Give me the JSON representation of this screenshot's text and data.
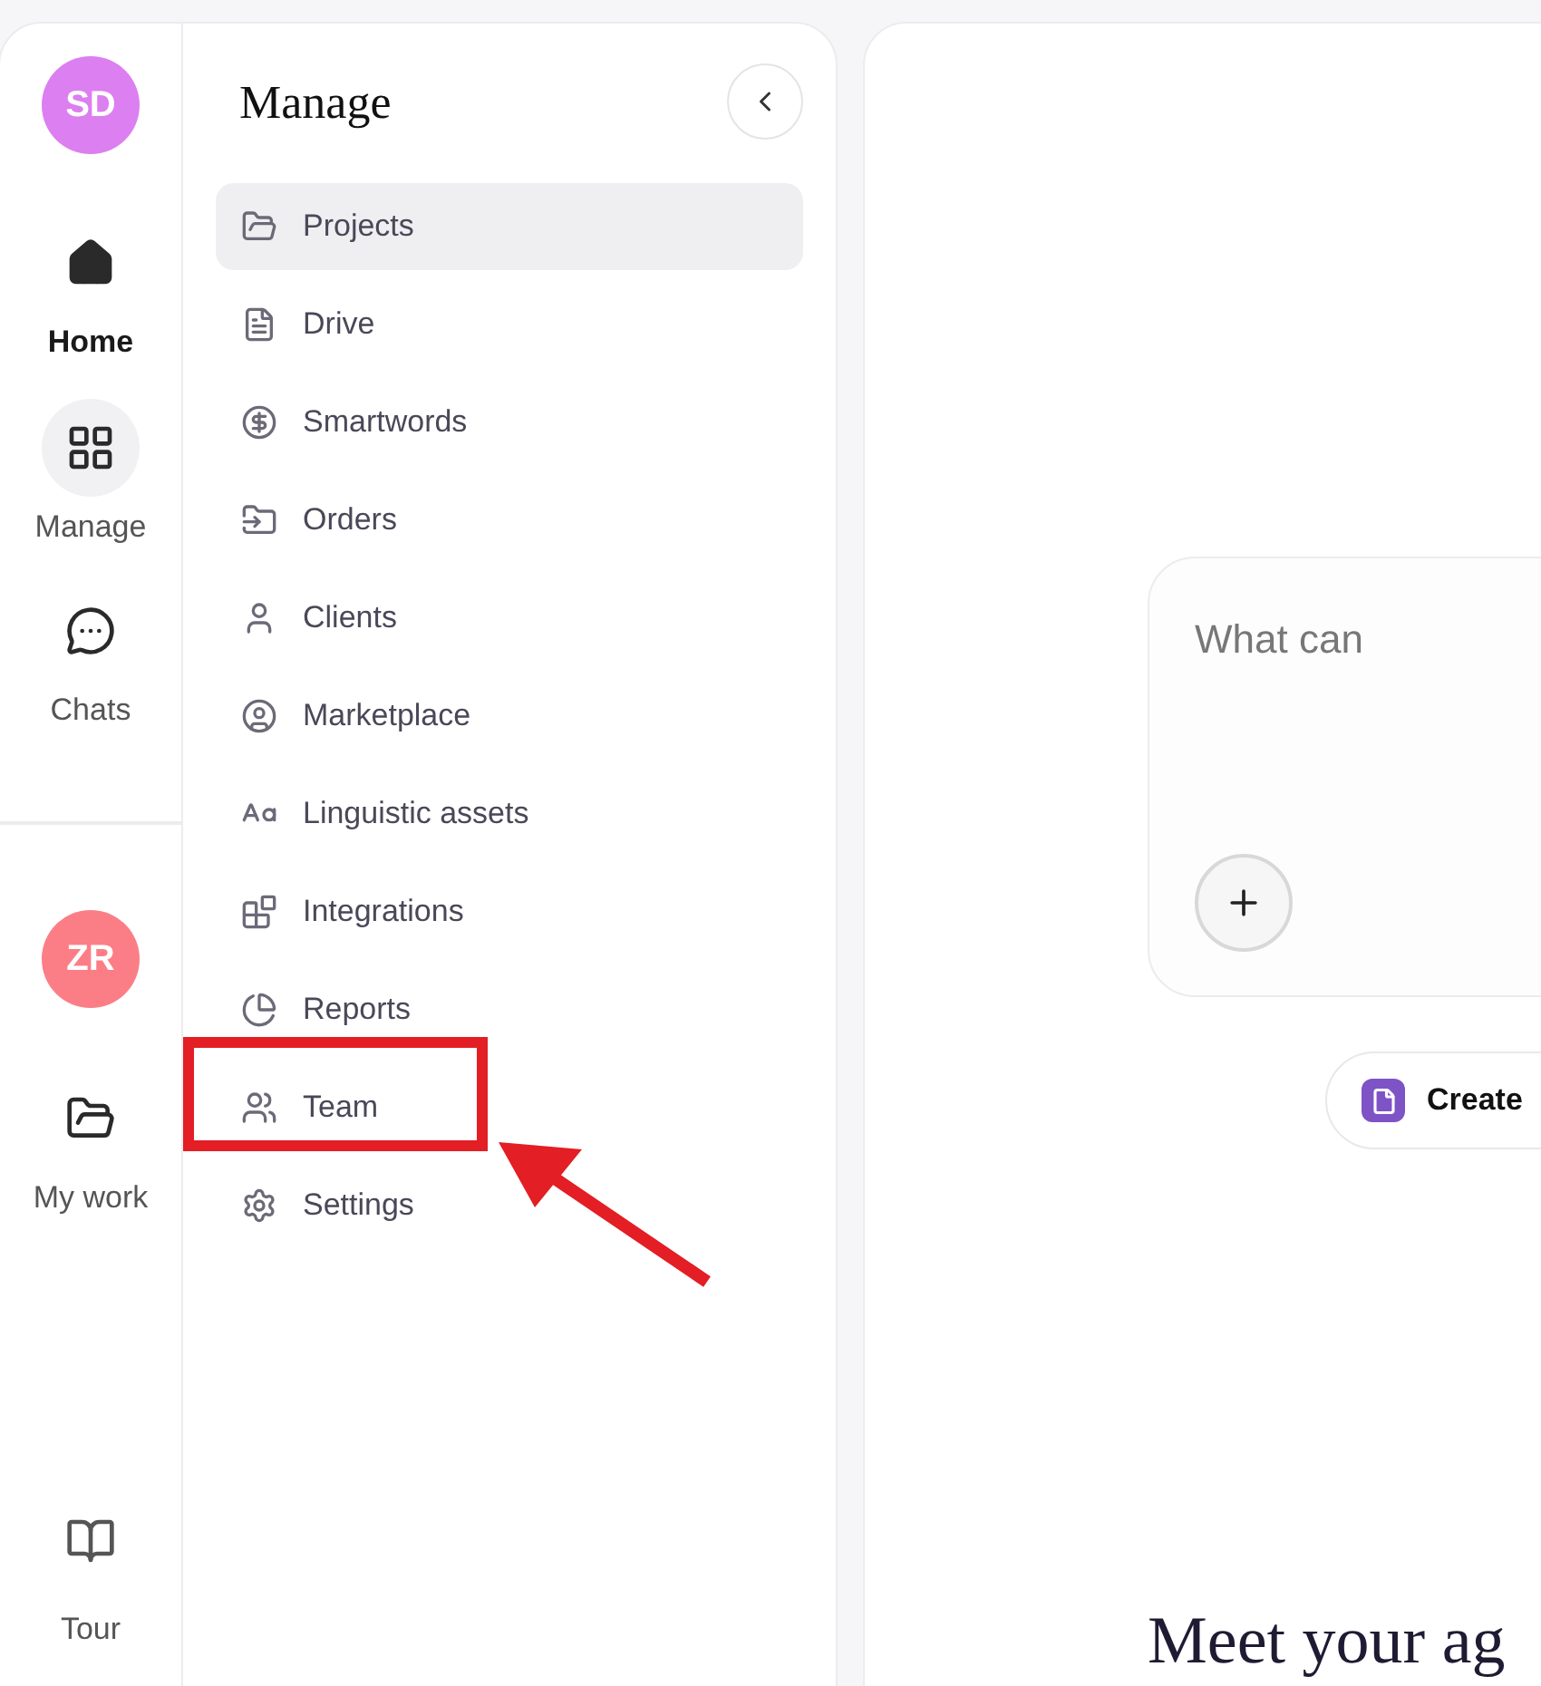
{
  "rail": {
    "top_avatar": "SD",
    "items": [
      {
        "label": "Home",
        "selected": true,
        "open": false
      },
      {
        "label": "Manage",
        "selected": false,
        "open": true
      },
      {
        "label": "Chats",
        "selected": false,
        "open": false
      }
    ],
    "workspace_avatar": "ZR",
    "work_items": [
      {
        "label": "My work",
        "selected": false,
        "open": false
      }
    ],
    "tour": "Tour"
  },
  "manage_panel": {
    "title": "Manage",
    "items": [
      {
        "label": "Projects",
        "selected": true
      },
      {
        "label": "Drive",
        "selected": false
      },
      {
        "label": "Smartwords",
        "selected": false
      },
      {
        "label": "Orders",
        "selected": false
      },
      {
        "label": "Clients",
        "selected": false
      },
      {
        "label": "Marketplace",
        "selected": false
      },
      {
        "label": "Linguistic assets",
        "selected": false
      },
      {
        "label": "Integrations",
        "selected": false
      },
      {
        "label": "Reports",
        "selected": false
      },
      {
        "label": "Team",
        "selected": false
      },
      {
        "label": "Settings",
        "selected": false
      }
    ]
  },
  "main": {
    "prompt": {
      "placeholder": "What can"
    },
    "create_button": "Create",
    "heading": "Meet your ag"
  }
}
